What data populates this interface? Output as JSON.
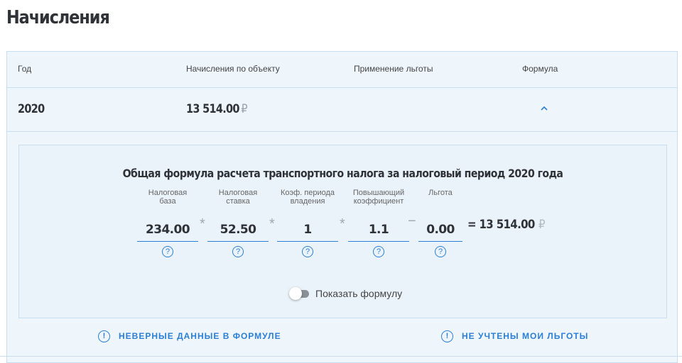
{
  "page": {
    "title": "Начисления"
  },
  "table": {
    "headers": {
      "year": "Год",
      "charges": "Начисления по объекту",
      "benefit": "Применение льготы",
      "formula": "Формула"
    },
    "row": {
      "year": "2020",
      "amount": "13 514.00",
      "currency": "₽",
      "expand_icon": "chevron-up-icon"
    }
  },
  "formula": {
    "title": "Общая формула расчета транспортного налога за налоговый период 2020 года",
    "fields": [
      {
        "label_line1": "Налоговая",
        "label_line2": "база",
        "value": "234.00"
      },
      {
        "label_line1": "Налоговая",
        "label_line2": "ставка",
        "value": "52.50"
      },
      {
        "label_line1": "Коэф. периода",
        "label_line2": "владения",
        "value": "1"
      },
      {
        "label_line1": "Повышающий",
        "label_line2": "коэффициент",
        "value": "1.1"
      },
      {
        "label_line1": "Льгота",
        "label_line2": "",
        "value": "0.00"
      }
    ],
    "operators": [
      "*",
      "*",
      "*",
      "−"
    ],
    "help_symbol": "?",
    "result": "= 13 514.00",
    "currency": "₽",
    "toggle": {
      "label": "Показать формулу",
      "checked": false
    }
  },
  "links": {
    "wrong_data": "НЕВЕРНЫЕ ДАННЫЕ В ФОРМУЛЕ",
    "benefits_missing": "НЕ УЧТЕНЫ МОИ ЛЬГОТЫ",
    "icon_symbol": "!"
  },
  "colors": {
    "accent": "#2b7fd4",
    "panel": "#eef5fb",
    "border": "#c9ddf0"
  }
}
